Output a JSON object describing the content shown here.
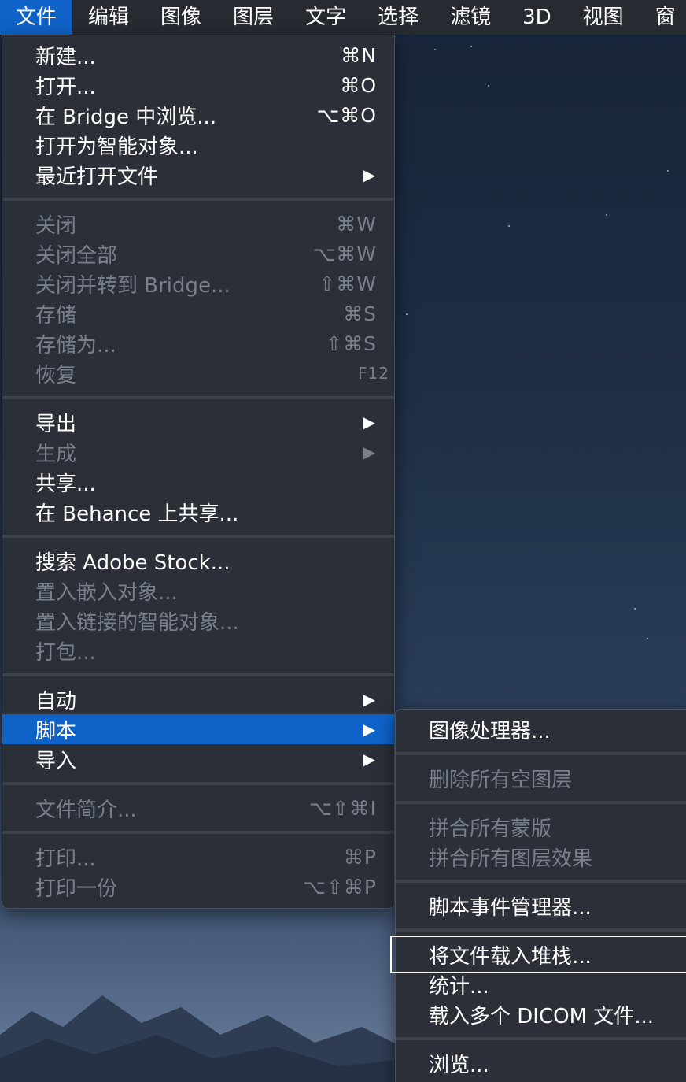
{
  "menubar": {
    "items": [
      "文件",
      "编辑",
      "图像",
      "图层",
      "文字",
      "选择",
      "滤镜",
      "3D",
      "视图",
      "窗"
    ],
    "active": "文件"
  },
  "file_menu": {
    "items": [
      {
        "label": "新建...",
        "shortcut": "⌘N",
        "enabled": true
      },
      {
        "label": "打开...",
        "shortcut": "⌘O",
        "enabled": true
      },
      {
        "label": "在 Bridge 中浏览...",
        "shortcut": "⌥⌘O",
        "enabled": true
      },
      {
        "label": "打开为智能对象...",
        "shortcut": "",
        "enabled": true
      },
      {
        "label": "最近打开文件",
        "shortcut": "▶",
        "enabled": true
      },
      {
        "label": "关闭",
        "shortcut": "⌘W",
        "enabled": false
      },
      {
        "label": "关闭全部",
        "shortcut": "⌥⌘W",
        "enabled": false
      },
      {
        "label": "关闭并转到 Bridge...",
        "shortcut": "⇧⌘W",
        "enabled": false
      },
      {
        "label": "存储",
        "shortcut": "⌘S",
        "enabled": false
      },
      {
        "label": "存储为...",
        "shortcut": "⇧⌘S",
        "enabled": false
      },
      {
        "label": "恢复",
        "shortcut": "F12",
        "enabled": false
      },
      {
        "label": "导出",
        "shortcut": "▶",
        "enabled": true
      },
      {
        "label": "生成",
        "shortcut": "▶",
        "enabled": false
      },
      {
        "label": "共享...",
        "shortcut": "",
        "enabled": true
      },
      {
        "label": "在 Behance 上共享...",
        "shortcut": "",
        "enabled": true
      },
      {
        "label": "搜索 Adobe Stock...",
        "shortcut": "",
        "enabled": true
      },
      {
        "label": "置入嵌入对象...",
        "shortcut": "",
        "enabled": false
      },
      {
        "label": "置入链接的智能对象...",
        "shortcut": "",
        "enabled": false
      },
      {
        "label": "打包...",
        "shortcut": "",
        "enabled": false
      },
      {
        "label": "自动",
        "shortcut": "▶",
        "enabled": true
      },
      {
        "label": "脚本",
        "shortcut": "▶",
        "enabled": true,
        "highlighted": true
      },
      {
        "label": "导入",
        "shortcut": "▶",
        "enabled": true
      },
      {
        "label": "文件简介...",
        "shortcut": "⌥⇧⌘I",
        "enabled": false
      },
      {
        "label": "打印...",
        "shortcut": "⌘P",
        "enabled": false
      },
      {
        "label": "打印一份",
        "shortcut": "⌥⇧⌘P",
        "enabled": false
      }
    ]
  },
  "scripts_submenu": {
    "items": [
      {
        "label": "图像处理器...",
        "enabled": true
      },
      {
        "label": "删除所有空图层",
        "enabled": false
      },
      {
        "label": "拼合所有蒙版",
        "enabled": false
      },
      {
        "label": "拼合所有图层效果",
        "enabled": false
      },
      {
        "label": "脚本事件管理器...",
        "enabled": true
      },
      {
        "label": "将文件载入堆栈...",
        "enabled": true,
        "focused": true
      },
      {
        "label": "统计...",
        "enabled": true
      },
      {
        "label": "载入多个 DICOM 文件...",
        "enabled": true
      },
      {
        "label": "浏览...",
        "enabled": true
      }
    ]
  },
  "colors": {
    "menu_bg": "#2a2f38",
    "highlight": "#0f63c8",
    "disabled_text": "#7a808a",
    "menubar_bg": "#262a31"
  }
}
